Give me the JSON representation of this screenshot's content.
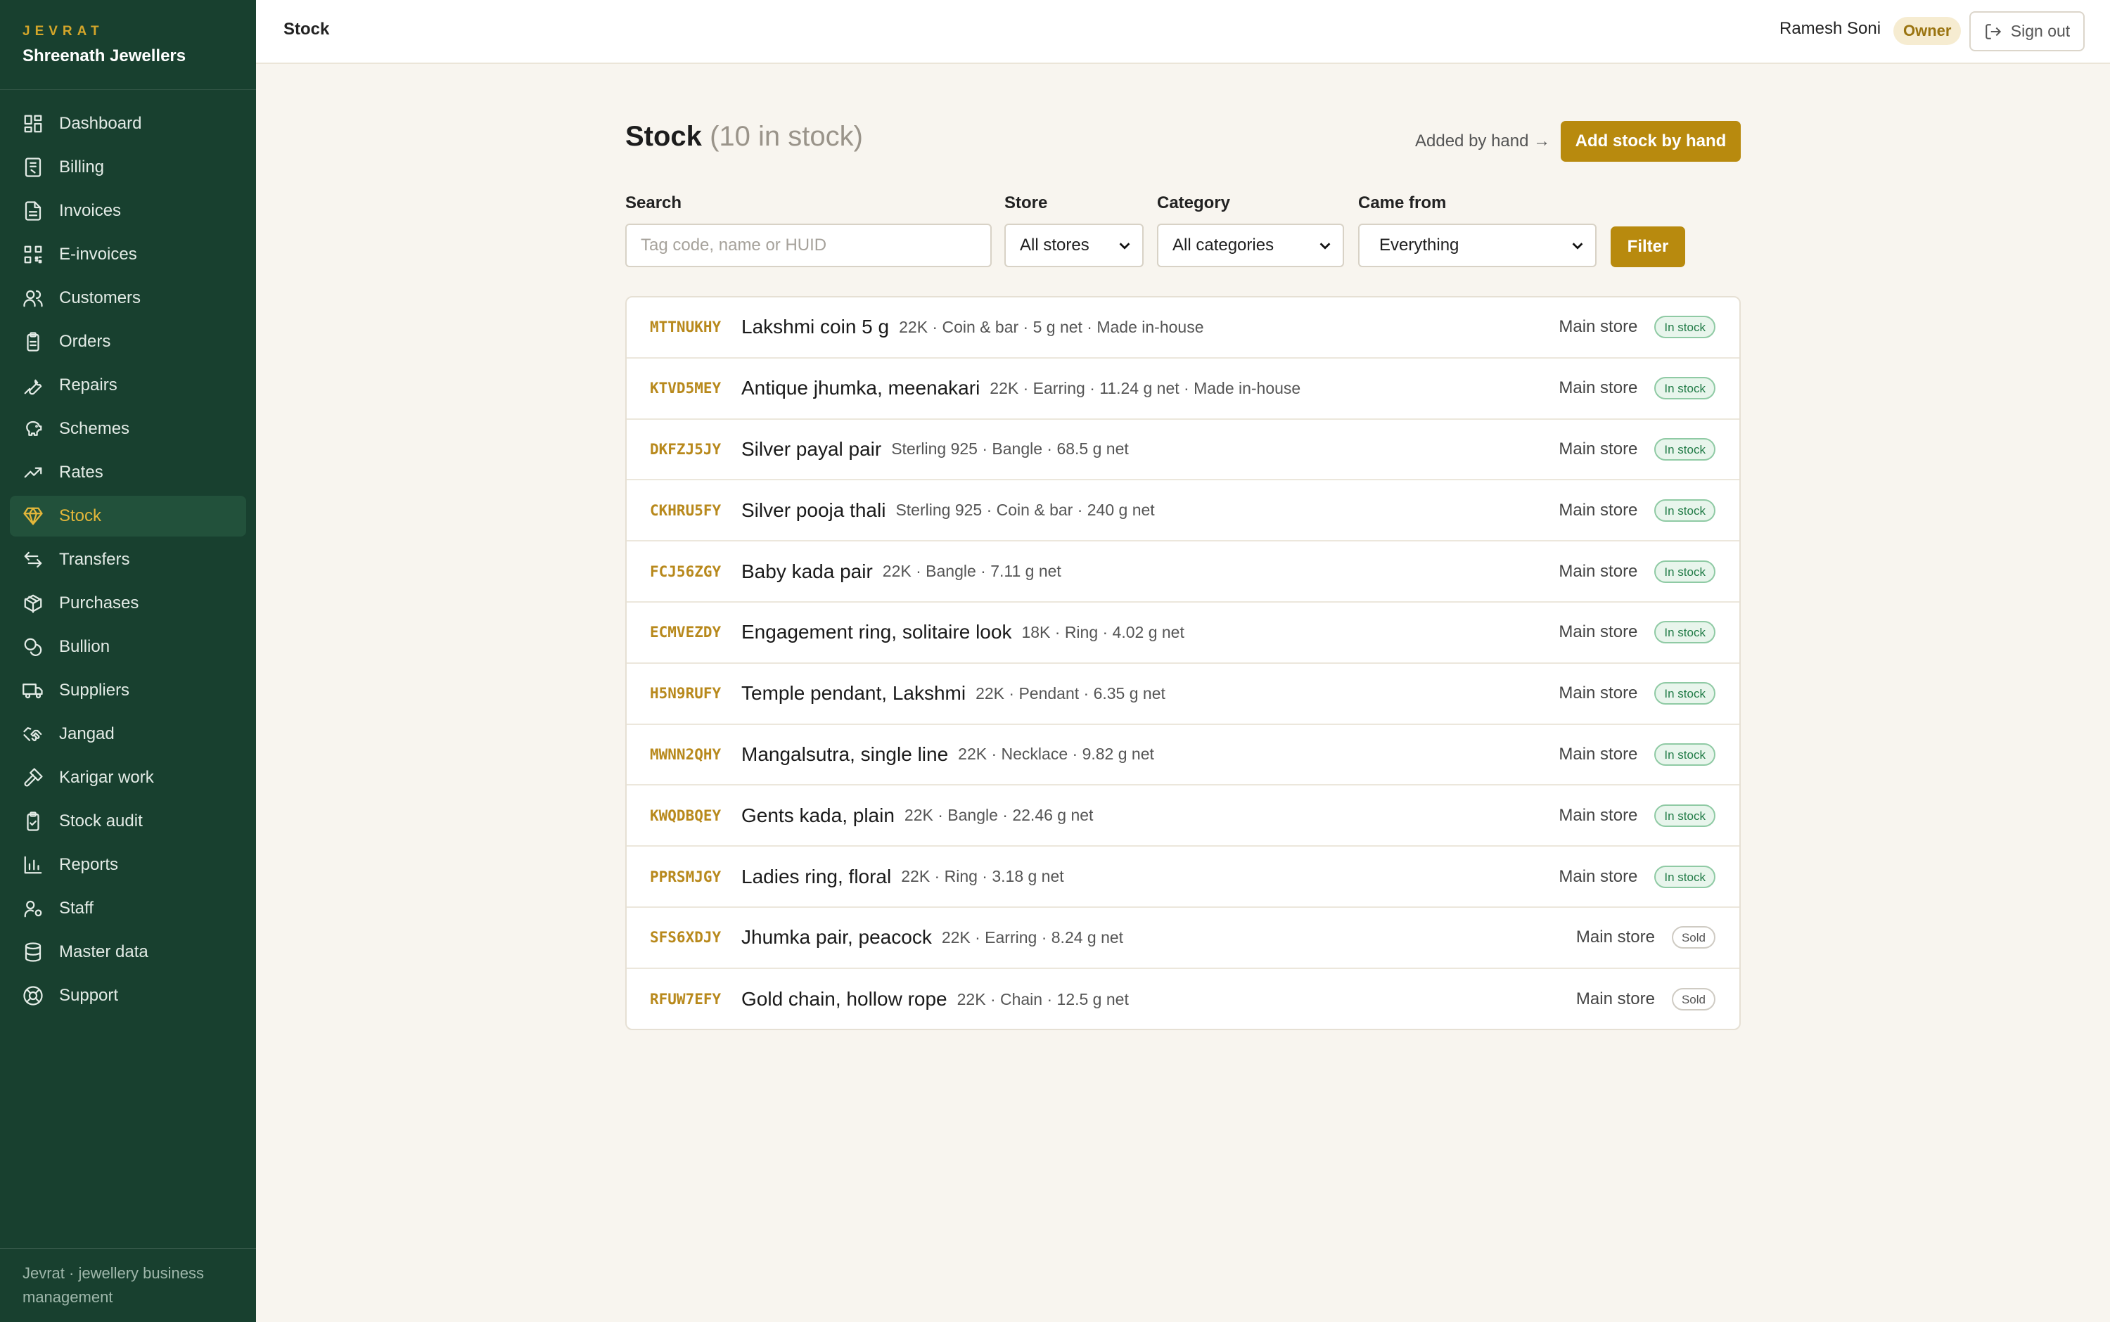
{
  "brand": {
    "mark": "JEVRAT",
    "store_name": "Shreenath Jewellers"
  },
  "sidebar": {
    "items": [
      {
        "label": "Dashboard",
        "icon": "dashboard-icon",
        "active": false
      },
      {
        "label": "Billing",
        "icon": "billing-icon",
        "active": false
      },
      {
        "label": "Invoices",
        "icon": "invoice-icon",
        "active": false
      },
      {
        "label": "E-invoices",
        "icon": "qr-code-icon",
        "active": false
      },
      {
        "label": "Customers",
        "icon": "users-icon",
        "active": false
      },
      {
        "label": "Orders",
        "icon": "clipboard-icon",
        "active": false
      },
      {
        "label": "Repairs",
        "icon": "wrench-icon",
        "active": false
      },
      {
        "label": "Schemes",
        "icon": "piggy-bank-icon",
        "active": false
      },
      {
        "label": "Rates",
        "icon": "trend-up-icon",
        "active": false
      },
      {
        "label": "Stock",
        "icon": "gem-icon",
        "active": true
      },
      {
        "label": "Transfers",
        "icon": "arrows-swap-icon",
        "active": false
      },
      {
        "label": "Purchases",
        "icon": "package-icon",
        "active": false
      },
      {
        "label": "Bullion",
        "icon": "coins-icon",
        "active": false
      },
      {
        "label": "Suppliers",
        "icon": "truck-icon",
        "active": false
      },
      {
        "label": "Jangad",
        "icon": "handshake-icon",
        "active": false
      },
      {
        "label": "Karigar work",
        "icon": "hammer-icon",
        "active": false
      },
      {
        "label": "Stock audit",
        "icon": "clipboard-check-icon",
        "active": false
      },
      {
        "label": "Reports",
        "icon": "bar-chart-icon",
        "active": false
      },
      {
        "label": "Staff",
        "icon": "user-cog-icon",
        "active": false
      },
      {
        "label": "Master data",
        "icon": "database-icon",
        "active": false
      },
      {
        "label": "Support",
        "icon": "lifebuoy-icon",
        "active": false
      }
    ],
    "footer": "Jevrat · jewellery business management"
  },
  "topbar": {
    "title": "Stock",
    "user_name": "Ramesh Soni",
    "role": "Owner",
    "signout_label": "Sign out"
  },
  "main": {
    "title": "Stock",
    "count_text": "(10 in stock)",
    "added_by_hand_link": "Added by hand →",
    "add_button": "Add stock by hand",
    "filters": {
      "search_label": "Search",
      "search_placeholder": "Tag code, name or HUID",
      "store_label": "Store",
      "store_value": "All stores",
      "category_label": "Category",
      "category_value": "All categories",
      "source_label": "Came from",
      "source_value": "Everything",
      "filter_button": "Filter"
    },
    "items": [
      {
        "tag": "MTTNUKHY",
        "name": "Lakshmi coin 5 g",
        "meta": "22K · Coin & bar · 5 g net · Made in-house",
        "store": "Main store",
        "status": "In stock"
      },
      {
        "tag": "KTVD5MEY",
        "name": "Antique jhumka, meenakari",
        "meta": "22K · Earring · 11.24 g net · Made in-house",
        "store": "Main store",
        "status": "In stock"
      },
      {
        "tag": "DKFZJ5JY",
        "name": "Silver payal pair",
        "meta": "Sterling 925 · Bangle · 68.5 g net",
        "store": "Main store",
        "status": "In stock"
      },
      {
        "tag": "CKHRU5FY",
        "name": "Silver pooja thali",
        "meta": "Sterling 925 · Coin & bar · 240 g net",
        "store": "Main store",
        "status": "In stock"
      },
      {
        "tag": "FCJ56ZGY",
        "name": "Baby kada pair",
        "meta": "22K · Bangle · 7.11 g net",
        "store": "Main store",
        "status": "In stock"
      },
      {
        "tag": "ECMVEZDY",
        "name": "Engagement ring, solitaire look",
        "meta": "18K · Ring · 4.02 g net",
        "store": "Main store",
        "status": "In stock"
      },
      {
        "tag": "H5N9RUFY",
        "name": "Temple pendant, Lakshmi",
        "meta": "22K · Pendant · 6.35 g net",
        "store": "Main store",
        "status": "In stock"
      },
      {
        "tag": "MWNN2QHY",
        "name": "Mangalsutra, single line",
        "meta": "22K · Necklace · 9.82 g net",
        "store": "Main store",
        "status": "In stock"
      },
      {
        "tag": "KWQDBQEY",
        "name": "Gents kada, plain",
        "meta": "22K · Bangle · 22.46 g net",
        "store": "Main store",
        "status": "In stock"
      },
      {
        "tag": "PPRSMJGY",
        "name": "Ladies ring, floral",
        "meta": "22K · Ring · 3.18 g net",
        "store": "Main store",
        "status": "In stock"
      },
      {
        "tag": "SFS6XDJY",
        "name": "Jhumka pair, peacock",
        "meta": "22K · Earring · 8.24 g net",
        "store": "Main store",
        "status": "Sold"
      },
      {
        "tag": "RFUW7EFY",
        "name": "Gold chain, hollow rope",
        "meta": "22K · Chain · 12.5 g net",
        "store": "Main store",
        "status": "Sold"
      }
    ]
  },
  "colors": {
    "sidebar_bg": "#18402f",
    "accent_gold": "#b88a0e",
    "page_bg": "#f8f5ef",
    "in_stock_green": "#1f7a45"
  }
}
